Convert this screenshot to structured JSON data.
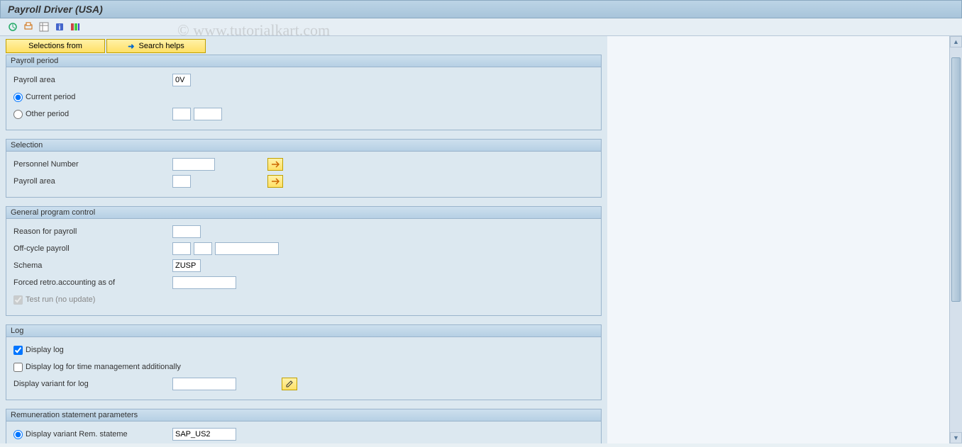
{
  "title": "Payroll Driver (USA)",
  "watermark": "© www.tutorialkart.com",
  "toolbar_icons": {
    "execute": "execute-icon",
    "print": "print-icon",
    "spreadsheet": "spreadsheet-icon",
    "info": "info-icon",
    "layout": "layout-icon"
  },
  "button_row": {
    "selections_from": "Selections from",
    "search_helps": "Search helps"
  },
  "groups": {
    "payroll_period": {
      "title": "Payroll period",
      "payroll_area_label": "Payroll area",
      "payroll_area_value": "0V",
      "current_period_label": "Current period",
      "current_period_selected": true,
      "other_period_label": "Other period",
      "other_period_val1": "",
      "other_period_val2": ""
    },
    "selection": {
      "title": "Selection",
      "personnel_number_label": "Personnel Number",
      "personnel_number_value": "",
      "payroll_area_label": "Payroll area",
      "payroll_area_value": ""
    },
    "general_program_control": {
      "title": "General program control",
      "reason_label": "Reason for payroll",
      "reason_value": "",
      "offcycle_label": "Off-cycle payroll",
      "offcycle_val1": "",
      "offcycle_val2": "",
      "offcycle_val3": "",
      "schema_label": "Schema",
      "schema_value": "ZUSP",
      "forced_retro_label": "Forced retro.accounting as of",
      "forced_retro_value": "",
      "test_run_label": "Test run (no update)",
      "test_run_checked": true
    },
    "log": {
      "title": "Log",
      "display_log_label": "Display log",
      "display_log_checked": true,
      "display_log_time_label": "Display log for time management additionally",
      "display_log_time_checked": false,
      "display_variant_label": "Display variant for log",
      "display_variant_value": ""
    },
    "remuneration": {
      "title": "Remuneration statement parameters",
      "display_variant_rem_label": "Display variant Rem. stateme",
      "display_variant_rem_value": "SAP_US2",
      "display_variant_rem_selected": true
    }
  }
}
